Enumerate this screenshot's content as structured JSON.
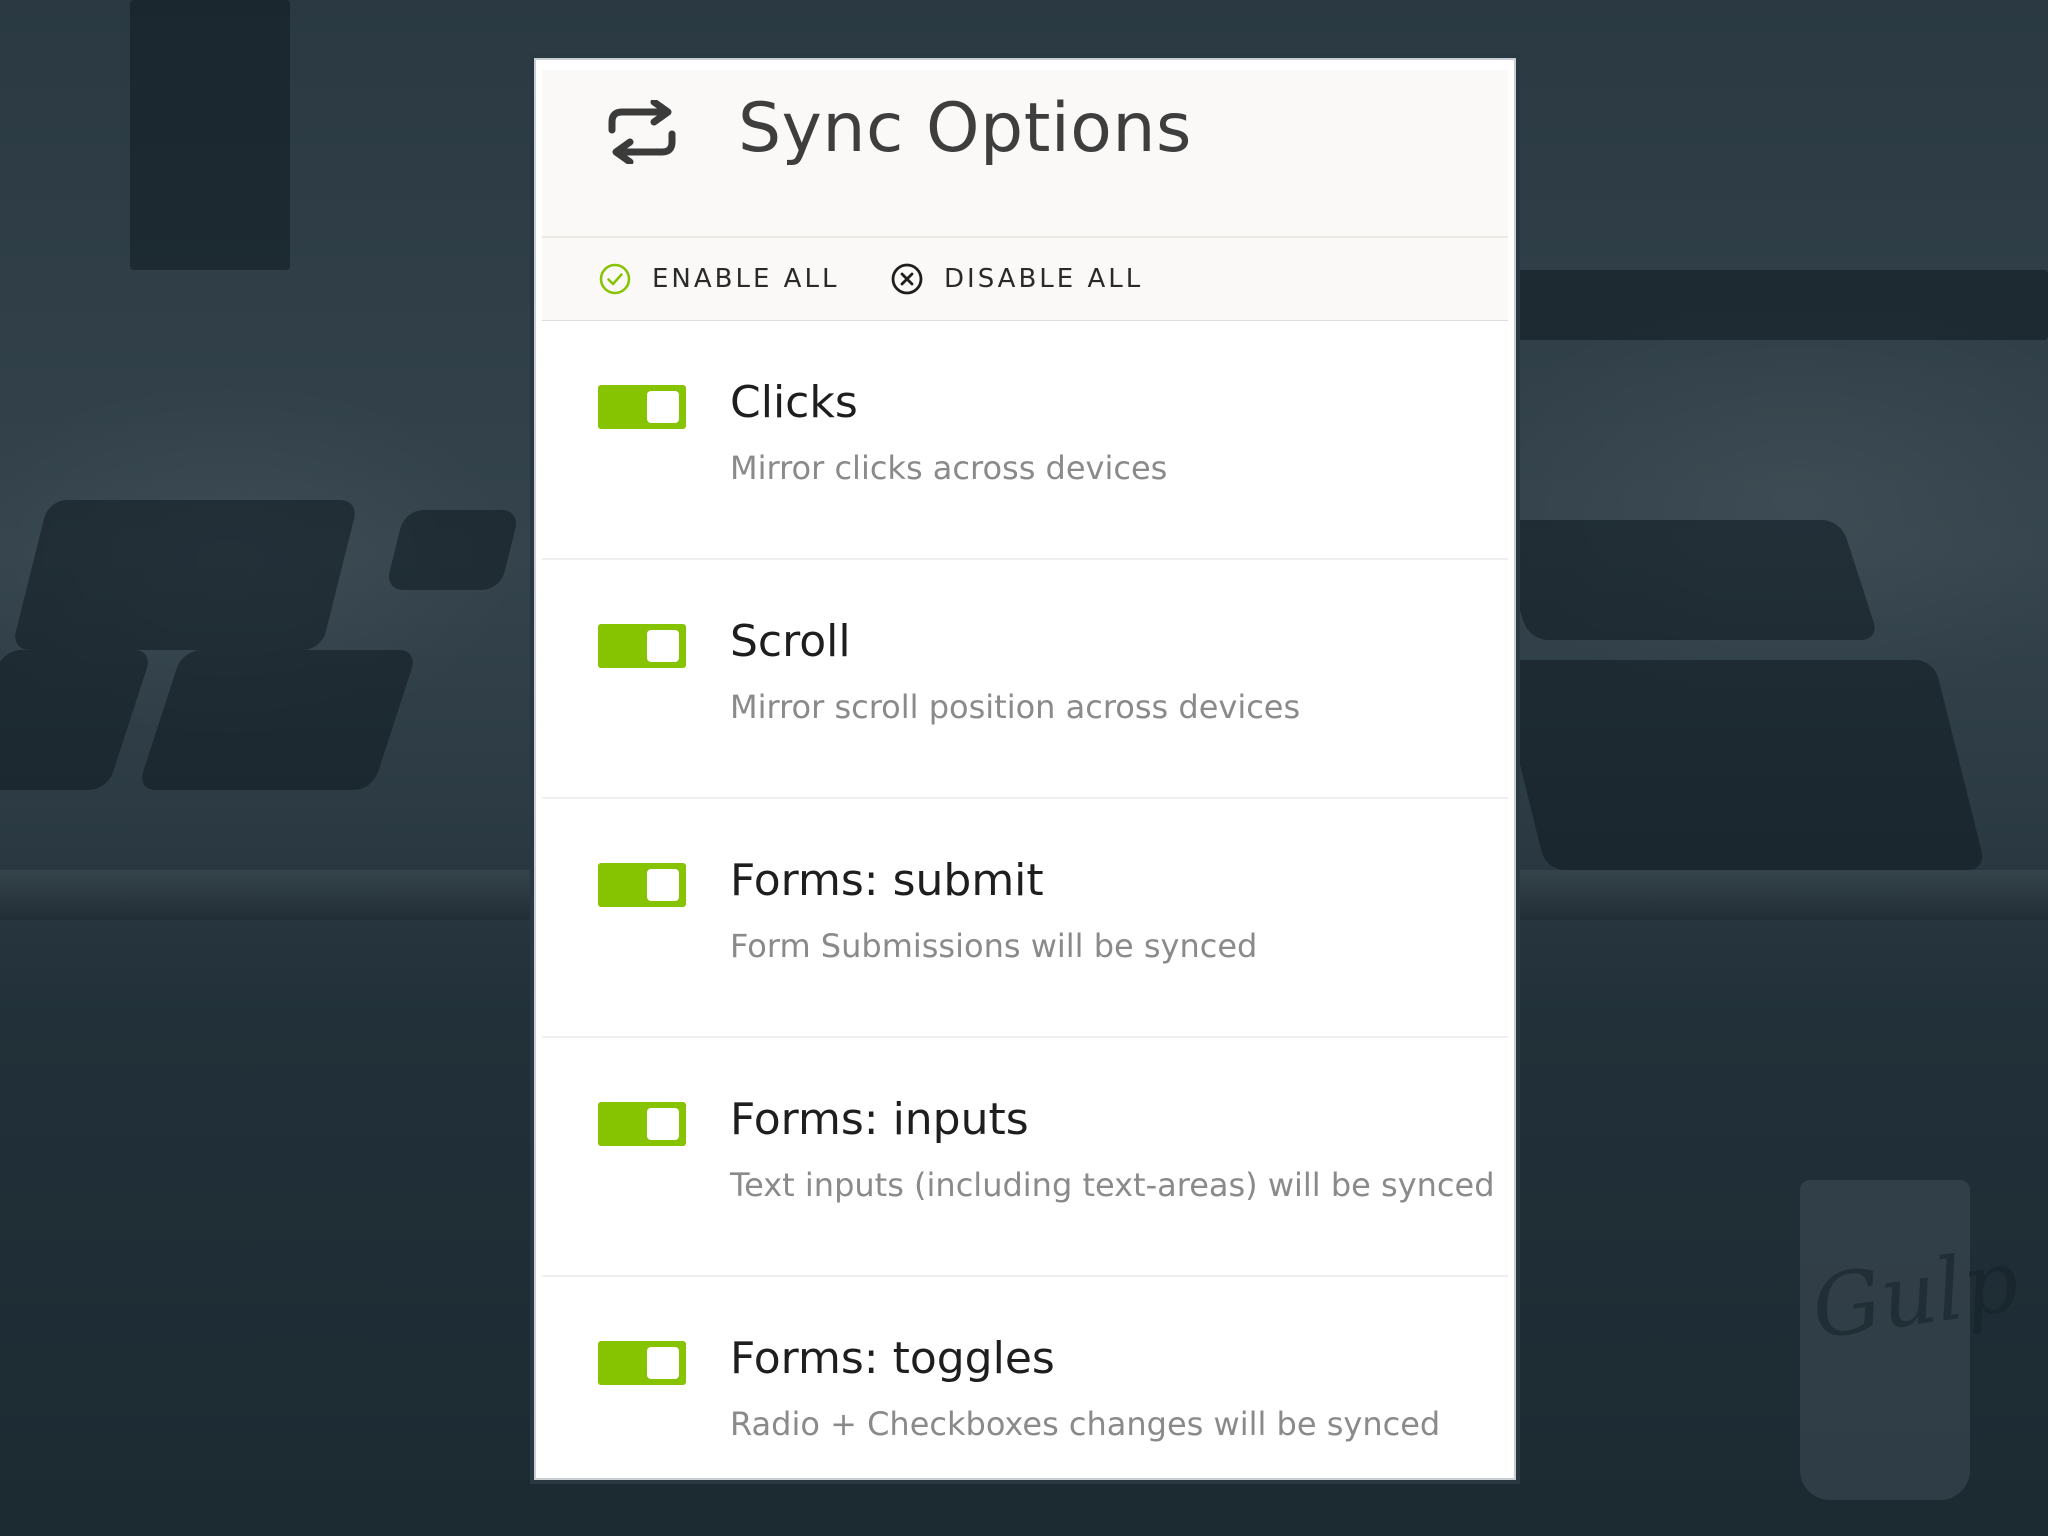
{
  "header": {
    "title": "Sync Options",
    "icon": "sync-arrows-icon"
  },
  "toolbar": {
    "enable_all": {
      "label": "ENABLE ALL",
      "icon": "check-circle-icon"
    },
    "disable_all": {
      "label": "DISABLE ALL",
      "icon": "x-circle-icon"
    }
  },
  "options": [
    {
      "title": "Clicks",
      "description": "Mirror clicks across devices",
      "enabled": true
    },
    {
      "title": "Scroll",
      "description": "Mirror scroll position across devices",
      "enabled": true
    },
    {
      "title": "Forms: submit",
      "description": "Form Submissions will be synced",
      "enabled": true
    },
    {
      "title": "Forms: inputs",
      "description": "Text inputs (including text-areas) will be synced",
      "enabled": true
    },
    {
      "title": "Forms: toggles",
      "description": "Radio + Checkboxes changes will be synced",
      "enabled": true
    }
  ],
  "background": {
    "cup_text": "Gulp"
  },
  "colors": {
    "accent": "#86c300",
    "backdrop": "#1f2e37",
    "title_text": "#3e3e3e",
    "desc_text": "#8a8a8a"
  }
}
